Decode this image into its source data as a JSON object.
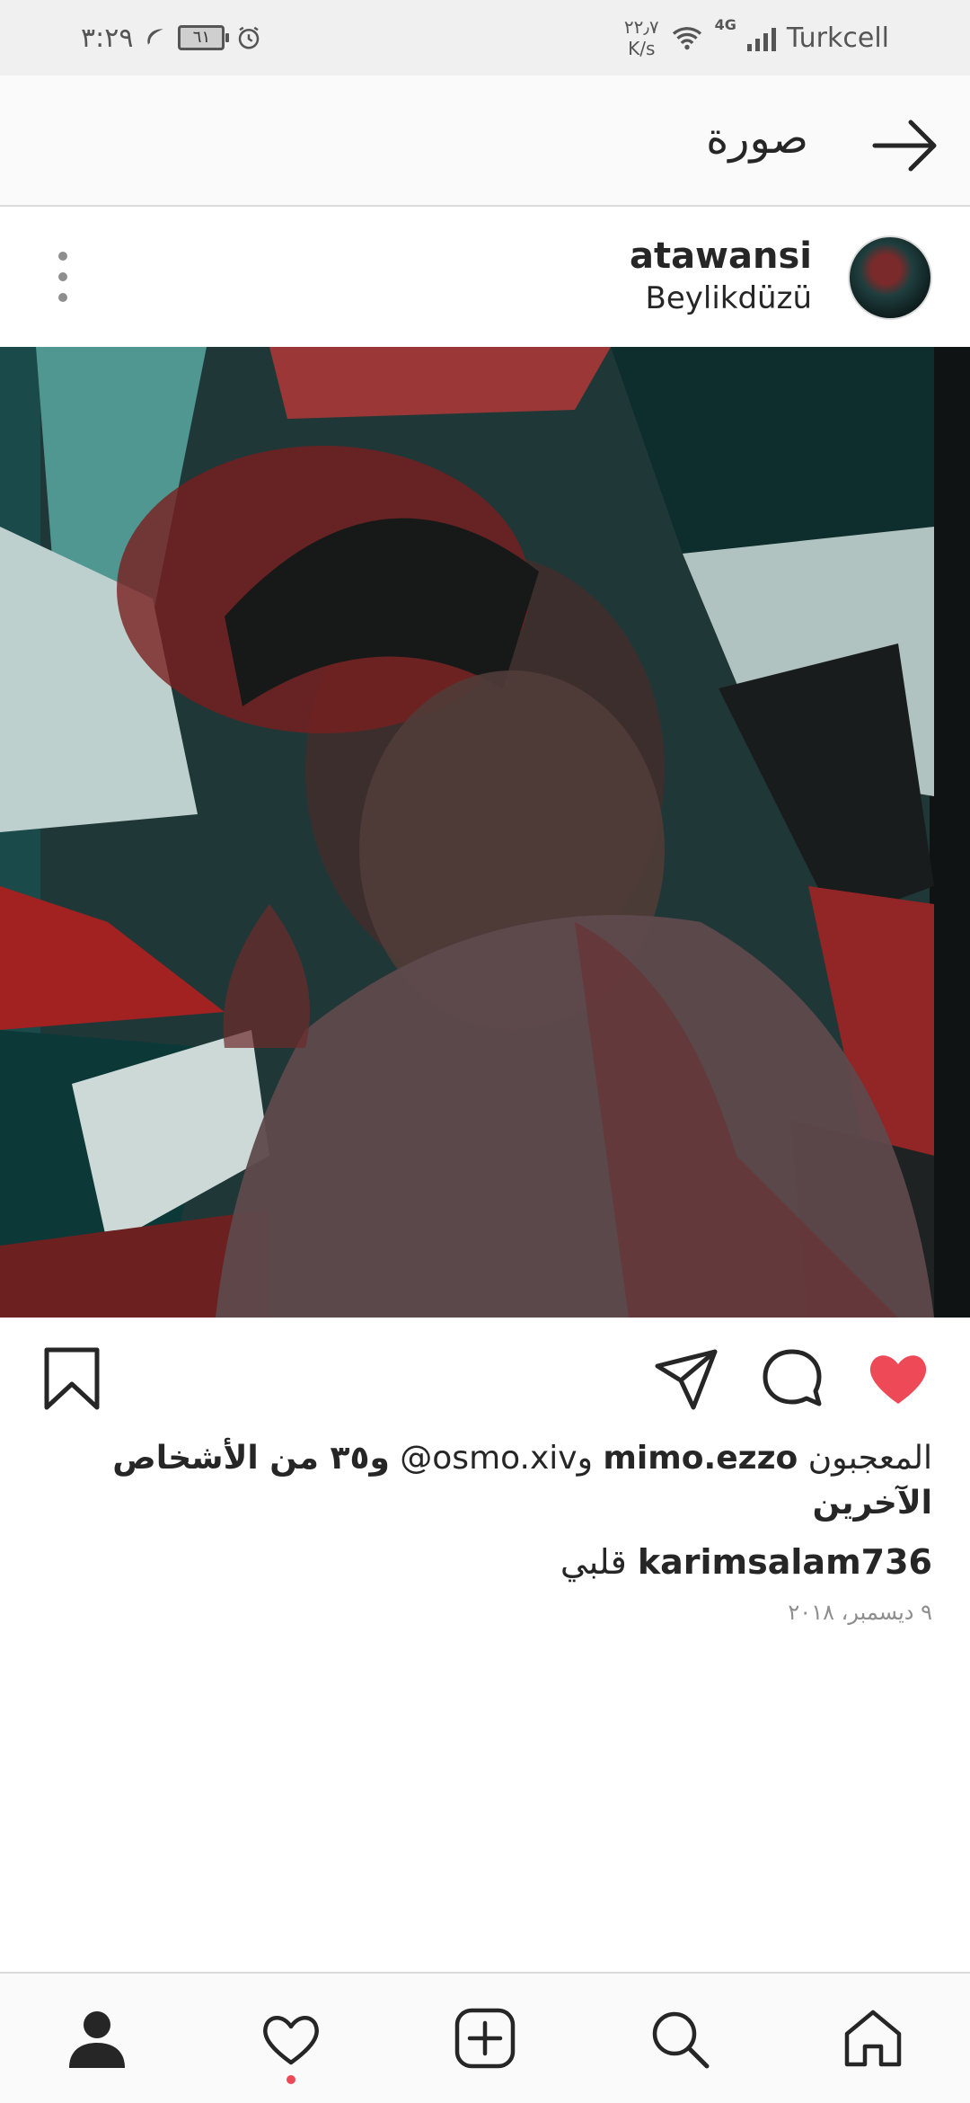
{
  "status_bar": {
    "time": "٣:٢٩",
    "battery": "٦١",
    "speed_value": "٢٢٫٧",
    "speed_unit": "K/s",
    "network": "4G",
    "carrier": "Turkcell"
  },
  "header": {
    "title": "صورة",
    "icons": [
      "back-arrow-icon"
    ]
  },
  "post": {
    "username": "atawansi",
    "location": "Beylikdüzü",
    "likes": {
      "prefix": "المعجبون",
      "user1": "mimo.ezzo",
      "and": "و",
      "user2": "osmo.xiv@",
      "others": "و٣٥ من الأشخاص الآخرين"
    },
    "caption": {
      "user": "karimsalam736",
      "text": "قلبي"
    },
    "date": "٩ ديسمبر، ٢٠١٨"
  },
  "actions": [
    "heart-icon",
    "comment-icon",
    "share-icon",
    "bookmark-icon"
  ],
  "bottom_nav": [
    "home-icon",
    "search-icon",
    "add-icon",
    "activity-icon",
    "profile-icon"
  ],
  "colors": {
    "like_red": "#ed4956",
    "text": "#262626",
    "muted": "#8e8e8e",
    "bar_bg": "#fafafa"
  }
}
